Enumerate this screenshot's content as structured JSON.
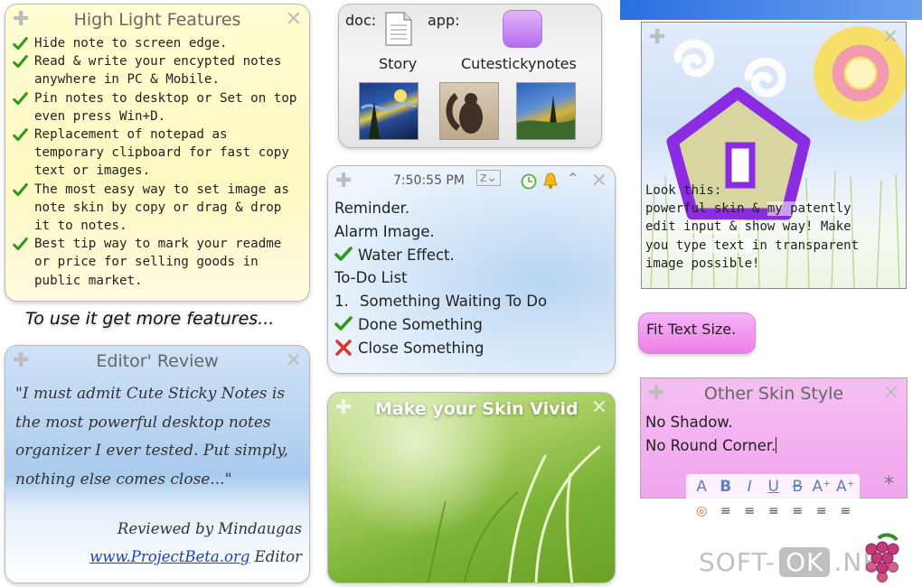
{
  "highlight_note": {
    "title": "High Light Features",
    "items": [
      "Hide note to screen edge.",
      "Read & write your encypted notes anywhere in PC & Mobile.",
      "Pin notes to desktop or Set on top even press Win+D.",
      "Replacement of notepad as temporary clipboard for fast copy text or images.",
      "The most easy way to set image as note skin by copy or drag & drop it to notes.",
      "Best tip way to mark your readme or price for selling goods in public market."
    ]
  },
  "more_features_text": "To use it get more features...",
  "editor_review": {
    "title": "Editor' Review",
    "quote": "\"I must admit Cute Sticky Notes is the most powerful desktop notes organizer I ever tested. Put simply, nothing else comes close...\"",
    "reviewer": "Reviewed by Mindaugas",
    "link_text": "www.ProjectBeta.org",
    "link_suffix": " Editor"
  },
  "doc_app_note": {
    "doc_label": "doc:",
    "app_label": "app:",
    "story_label": "Story",
    "app_name": "Cutestickynotes"
  },
  "reminder_note": {
    "time": "7:50:55 PM",
    "snooze": "z",
    "reminder": "Reminder.",
    "alarm": "Alarm Image.",
    "water": "Water Effect.",
    "todo": "To-Do List",
    "item_num": "1.",
    "item_waiting": "Something Waiting To Do",
    "item_done": "Done Something",
    "item_close": "Close Something"
  },
  "grass_note": {
    "title": "Make your Skin Vivid"
  },
  "skin_note": {
    "line1": "Look this:",
    "line2a": "powerful skin & ",
    "line2b": "my patently",
    "line3a": "edit ",
    "line3b": "input & ",
    "line3c": "show way! Make",
    "line4a": "you ",
    "line4b": "type text ",
    "line4c": "in transparent",
    "line5": "image possible!"
  },
  "fit_text_button": "Fit Text Size.",
  "other_skin_note": {
    "title": "Other Skin Style",
    "line1": "No Shadow.",
    "line2": "No Round Corner."
  },
  "format_toolbar": {
    "row1": [
      "A",
      "B",
      "I",
      "U",
      "B",
      "A⁺",
      "A⁺"
    ],
    "row2": [
      "◎",
      "≡",
      "≡",
      "≡",
      "≡",
      "≡",
      "≡"
    ],
    "asterisk": "*"
  },
  "watermark": {
    "left": "SOFT-",
    "ok": "OK",
    "right": ".NET"
  },
  "colors": {
    "yellow_note": "#fff9c2",
    "blue_note": "#bcd6f2",
    "pink_note": "#f3aff0",
    "check_green": "#2c9b1c",
    "purple_house": "#8a2be2"
  },
  "icons": {
    "check": "check-icon",
    "cross": "cross-icon",
    "clock": "clock-icon",
    "bell": "bell-icon",
    "plus": "plus-icon",
    "close": "close-icon"
  }
}
